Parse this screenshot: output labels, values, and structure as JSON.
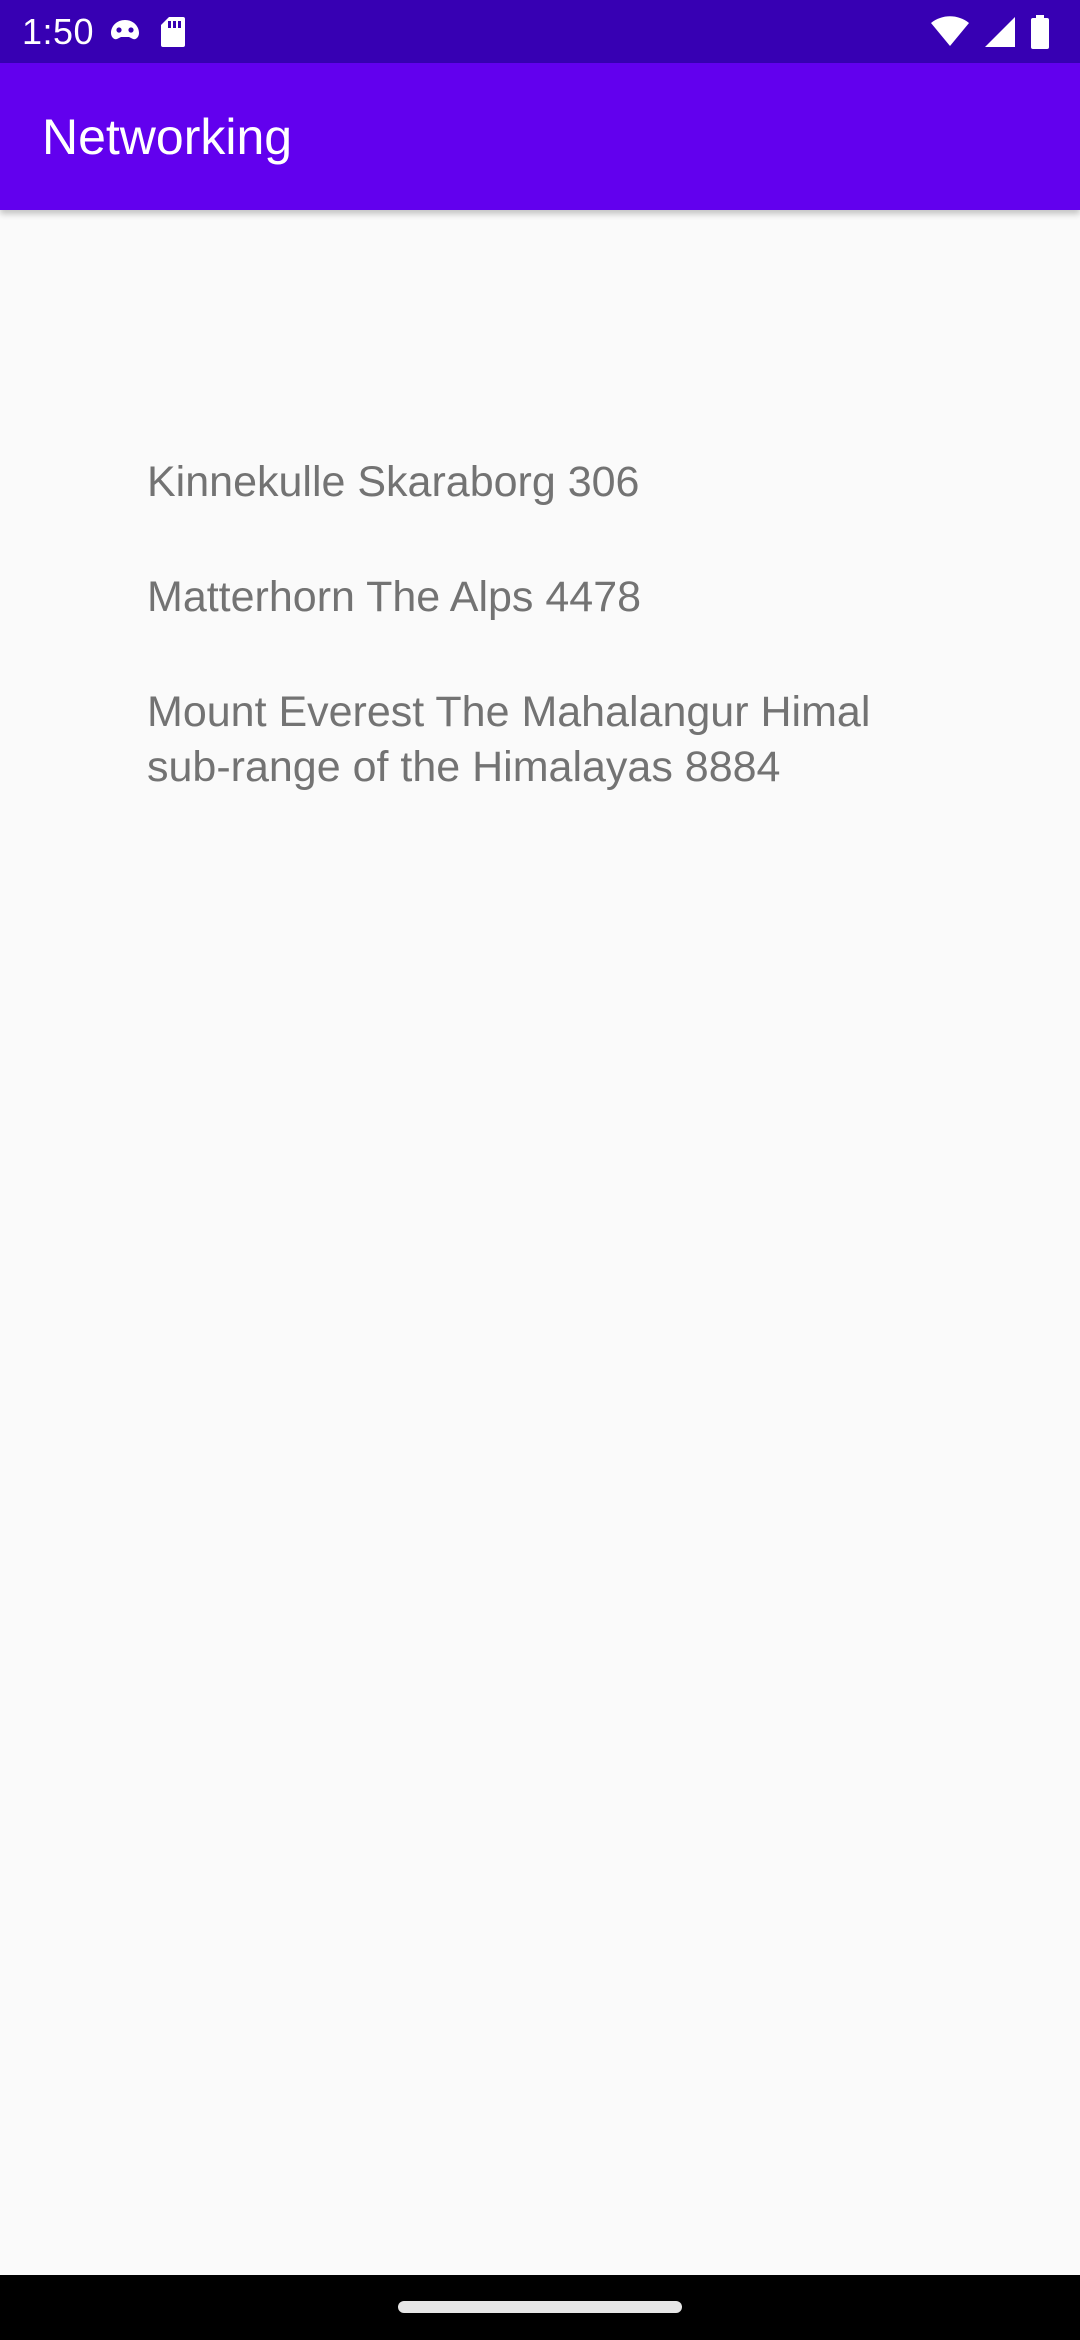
{
  "status_bar": {
    "time": "1:50",
    "left_icons": [
      "gamepad-icon",
      "sd-card-icon"
    ],
    "right_icons": [
      "wifi-icon",
      "cellular-signal-icon",
      "battery-icon"
    ],
    "background": "#3700b3"
  },
  "app_bar": {
    "title": "Networking",
    "background": "#6200ee"
  },
  "list": {
    "items": [
      "Kinnekulle Skaraborg 306",
      "Matterhorn The Alps 4478",
      "Mount Everest The Mahalangur Himal sub-range of the Himalayas 8884"
    ]
  },
  "nav_bar": {
    "background": "#000000"
  }
}
